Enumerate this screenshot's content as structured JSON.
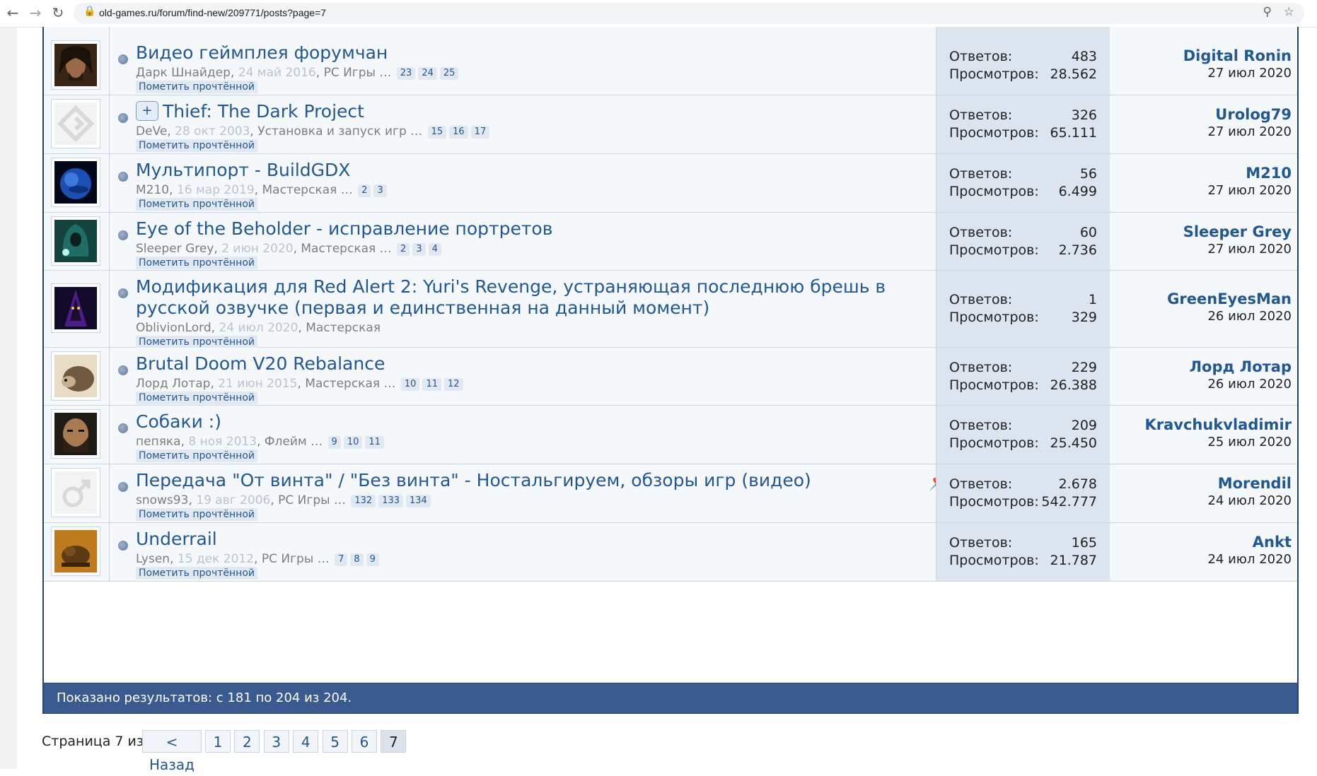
{
  "browser": {
    "back_icon": "arrow-left-icon",
    "forward_icon": "arrow-right-icon",
    "reload_icon": "reload-icon",
    "lock_icon": "lock-icon",
    "url": "old-games.ru/forum/find-new/209771/posts?page=7",
    "zoom_icon": "zoom-icon",
    "star_icon": "star-icon"
  },
  "threads": [
    {
      "avatar": "dark-haired-man",
      "title": "Видео геймплея форумчан",
      "author": "Дарк Шнайдер",
      "date": "24 май 2016",
      "forum": "PC Игры",
      "pages": [
        "23",
        "24",
        "25"
      ],
      "mark": "Пометить прочтённой",
      "replies_label": "Ответов:",
      "replies": "483",
      "views_label": "Просмотров:",
      "views": "28.562",
      "last_user": "Digital Ronin",
      "last_date": "27 июл 2020"
    },
    {
      "avatar": "default-logo",
      "prefix": "+",
      "title": "Thief: The Dark Project",
      "author": "DeVe",
      "date": "28 окт 2003",
      "forum": "Установка и запуск игр",
      "pages": [
        "15",
        "16",
        "17"
      ],
      "mark": "Пометить прочтённой",
      "replies_label": "Ответов:",
      "replies": "326",
      "views_label": "Просмотров:",
      "views": "65.111",
      "last_user": "Urolog79",
      "last_date": "27 июл 2020"
    },
    {
      "avatar": "blue-planet",
      "title": "Мультипорт - BuildGDX",
      "author": "M210",
      "date": "16 мар 2019",
      "forum": "Мастерская",
      "pages": [
        "2",
        "3"
      ],
      "mark": "Пометить прочтённой",
      "replies_label": "Ответов:",
      "replies": "56",
      "views_label": "Просмотров:",
      "views": "6.499",
      "last_user": "M210",
      "last_date": "27 июл 2020"
    },
    {
      "avatar": "hooded-figure",
      "title": "Eye of the Beholder - исправление портретов",
      "author": "Sleeper Grey",
      "date": "2 июн 2020",
      "forum": "Мастерская",
      "pages": [
        "2",
        "3",
        "4"
      ],
      "mark": "Пометить прочтённой",
      "replies_label": "Ответов:",
      "replies": "60",
      "views_label": "Просмотров:",
      "views": "2.736",
      "last_user": "Sleeper Grey",
      "last_date": "27 июл 2020"
    },
    {
      "avatar": "dark-mage",
      "title": "Модификация для Red Alert 2: Yuri's Revenge, устраняющая последнюю брешь в русской озвучке (первая и единственная на данный момент)",
      "author": "OblivionLord",
      "date": "24 июл 2020",
      "forum": "Мастерская",
      "pages": [],
      "mark": "Пометить прочтённой",
      "replies_label": "Ответов:",
      "replies": "1",
      "views_label": "Просмотров:",
      "views": "329",
      "last_user": "GreenEyesMan",
      "last_date": "26 июл 2020"
    },
    {
      "avatar": "hedgehog",
      "title": "Brutal Doom V20 Rebalance",
      "author": "Лорд Лотар",
      "date": "21 июн 2015",
      "forum": "Мастерская",
      "pages": [
        "10",
        "11",
        "12"
      ],
      "mark": "Пометить прочтённой",
      "replies_label": "Ответов:",
      "replies": "229",
      "views_label": "Просмотров:",
      "views": "26.388",
      "last_user": "Лорд Лотар",
      "last_date": "26 июл 2020"
    },
    {
      "avatar": "bearded-face",
      "title": "Собаки :)",
      "author": "пепяка",
      "date": "8 ноя 2013",
      "forum": "Флейм",
      "pages": [
        "9",
        "10",
        "11"
      ],
      "mark": "Пометить прочтённой",
      "replies_label": "Ответов:",
      "replies": "209",
      "views_label": "Просмотров:",
      "views": "25.450",
      "last_user": "Kravchukvladimir",
      "last_date": "25 июл 2020"
    },
    {
      "avatar": "male-symbol",
      "title": "Передача \"От винта\" / \"Без винта\" - Ностальгируем, обзоры игр (видео)",
      "pinned": true,
      "author": "snows93",
      "date": "19 авг 2006",
      "forum": "PC Игры",
      "pages": [
        "132",
        "133",
        "134"
      ],
      "mark": "Пометить прочтённой",
      "replies_label": "Ответов:",
      "replies": "2.678",
      "views_label": "Просмотров:",
      "views": "542.777",
      "last_user": "Morendil",
      "last_date": "24 июл 2020"
    },
    {
      "avatar": "creature",
      "title": "Underrail",
      "author": "Lysen",
      "date": "15 дек 2012",
      "forum": "PC Игры",
      "pages": [
        "7",
        "8",
        "9"
      ],
      "mark": "Пометить прочтённой",
      "replies_label": "Ответов:",
      "replies": "165",
      "views_label": "Просмотров:",
      "views": "21.787",
      "last_user": "Ankt",
      "last_date": "24 июл 2020"
    }
  ],
  "footer": {
    "results": "Показано результатов: с 181 по 204 из 204."
  },
  "pagination": {
    "label": "Страница 7 из 7",
    "prev": "< Назад",
    "pages": [
      "1",
      "2",
      "3",
      "4",
      "5",
      "6",
      "7"
    ],
    "current": "7"
  },
  "colors": {
    "link": "#22578f",
    "footer_bar": "#3b5a8f",
    "stats_bg": "#dbe4ef",
    "row_bg": "#f5f8fb"
  }
}
